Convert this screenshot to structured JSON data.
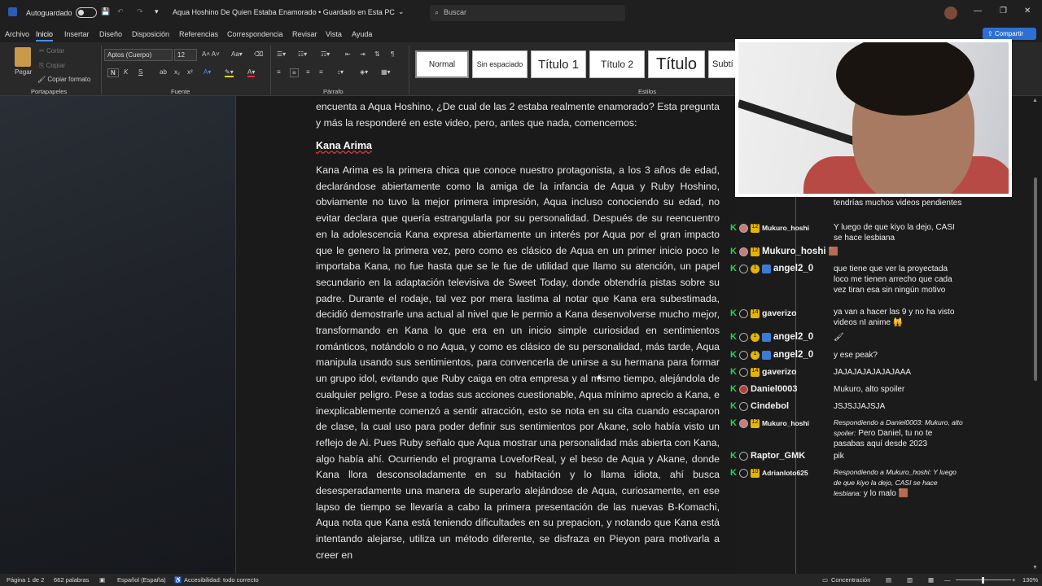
{
  "titlebar": {
    "autosave_label": "Autoguardado",
    "doc_title": "Aqua Hoshino De Quien Estaba Enamorado • Guardado en Esta PC",
    "search_placeholder": "Buscar",
    "win_minimize": "—",
    "win_maximize": "❐",
    "win_close": "✕"
  },
  "menu": {
    "items": [
      "Archivo",
      "Inicio",
      "Insertar",
      "Diseño",
      "Disposición",
      "Referencias",
      "Correspondencia",
      "Revisar",
      "Vista",
      "Ayuda"
    ],
    "active": "Inicio",
    "share_label": "Compartir"
  },
  "ribbon": {
    "clipboard": {
      "paste": "Pegar",
      "cut": "Cortar",
      "copy": "Copiar",
      "format_painter": "Copiar formato",
      "group": "Portapapeles"
    },
    "font": {
      "name": "Aptos (Cuerpo)",
      "size": "12",
      "group": "Fuente"
    },
    "paragraph": {
      "group": "Párrafo"
    },
    "styles": {
      "group": "Estilos",
      "items": [
        "Normal",
        "Sin espaciado",
        "Título 1",
        "Título 2",
        "Título",
        "Subtí"
      ]
    }
  },
  "document": {
    "intro": "encuenta a Aqua Hoshino, ¿De cual de las 2 estaba realmente enamorado? Esta pregunta y más la responderé en este video, pero, antes que nada, comencemos:",
    "heading": "Kana Arima",
    "body": "Kana Arima es la primera chica que conoce nuestro protagonista, a los 3 años de edad, declarándose abiertamente como la amiga de la infancia de Aqua y Ruby Hoshino, obviamente no tuvo la mejor primera impresión, Aqua incluso conociendo su edad, no evitar declara que quería estrangularla por su personalidad. Después de su reencuentro en la adolescencia Kana expresa abiertamente un interés por Aqua por el gran impacto que le genero la primera vez, pero como es clásico de Aqua en un primer inicio poco le importaba Kana, no fue hasta que se le fue de utilidad que llamo su atención, un papel secundario en la adaptación televisiva de Sweet Today, donde obtendría pistas sobre su padre. Durante el rodaje, tal vez por mera lastima al notar que Kana era subestimada, decidió demostrarle una actual al nivel que le permio a Kana desenvolverse mucho mejor, transformando en Kana lo que era en un inicio simple curiosidad en sentimientos románticos, notándolo o no Aqua, y como es clásico de su personalidad, más tarde, Aqua manipula usando sus sentimientos, para convencerla de unirse a su hermana para formar un grupo idol, evitando que Ruby caiga en otra empresa y al mismo tiempo, alejándola de cualquier peligro. Pese a todas sus acciones cuestionable, Aqua mínimo aprecio a Kana, e inexplicablemente comenzó a sentir atracción, esto se nota en su cita cuando escaparon de clase, la cual uso para poder definir sus sentimientos por Akane, solo había visto un reflejo de Ai. Pues Ruby señalo que Aqua mostrar una personalidad más abierta con Kana, algo había ahí. Ocurriendo el programa LoveforReal, y el beso de Aqua y Akane, donde Kana llora desconsoladamente en su habitación y lo llama idiota, ahí busca desesperadamente una manera de superarlo alejándose de Aqua, curiosamente, en ese lapso de tiempo se llevaría a cabo la primera presentación de las nuevas B-Komachi, Aqua nota que Kana está teniendo dificultades en su prepacion, y notando que Kana está intentando alejarse, utiliza un método diferente, se disfraza en Pieyon para motivarla a creer en"
  },
  "chat": [
    {
      "user": "",
      "badge": "",
      "message": "tendrías muchos videos pendientes"
    },
    {
      "user": "Mukuro_hoshi",
      "badge": "12",
      "message": "Y luego de que kiyo la dejo, CASI se hace lesbiana"
    },
    {
      "user": "Mukuro_hoshi",
      "badge": "12",
      "message": "🟫"
    },
    {
      "user": "angel2_0",
      "badge": "1",
      "message": "que tiene que ver la proyectada loco me tienen arrecho que cada vez tiran esa sin ningún motivo"
    },
    {
      "user": "gaverizo",
      "badge": "14",
      "message": "ya van a hacer las 9 y no ha visto videos nI anime 🙀"
    },
    {
      "user": "angel2_0",
      "badge": "1",
      "message": "🖌"
    },
    {
      "user": "angel2_0",
      "badge": "1",
      "message": "y ese peak?"
    },
    {
      "user": "gaverizo",
      "badge": "14",
      "message": "JAJAJAJAJAJAJAAA"
    },
    {
      "user": "Daniel0003",
      "badge": "",
      "message": "Mukuro, alto spoiler"
    },
    {
      "user": "Cindebol",
      "badge": "",
      "message": "JSJSJJAJSJA"
    },
    {
      "user": "Mukuro_hoshi",
      "badge": "12",
      "reply": "Respondiendo a Daniel0003: Mukuro, alto spoiler:",
      "message": "Pero Daniel, tu no te pasabas aquí desde 2023"
    },
    {
      "user": "Raptor_GMK",
      "badge": "",
      "message": "pik"
    },
    {
      "user": "Adrianloto625",
      "badge": "10",
      "reply": "Respondiendo a Mukuro_hoshi: Y luego de que kiyo la dejo, CASI se hace lesbiana:",
      "message": "y lo malo 🟫"
    }
  ],
  "status": {
    "page": "Página 1 de 2",
    "words": "662 palabras",
    "language": "Español (España)",
    "accessibility": "Accesibilidad: todo correcto",
    "focus": "Concentración",
    "zoom": "130%"
  },
  "colors": {
    "accent": "#2d6fd2",
    "mod_icon": "#2fd158",
    "badge": "#e6b400"
  }
}
